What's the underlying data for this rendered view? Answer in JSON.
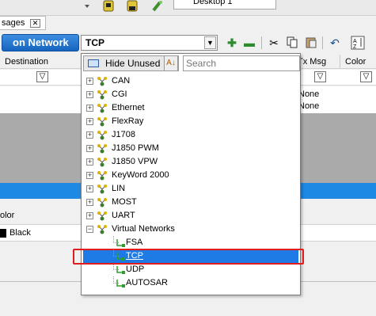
{
  "tabs": {
    "messages_tab_label": "sages",
    "desktop_tab_label": "Desktop 1"
  },
  "network_bar": {
    "network_button_label": "on Network",
    "selected_network": "TCP"
  },
  "grid": {
    "columns": [
      {
        "label": "Destination"
      },
      {
        "label": "Tx Msg"
      },
      {
        "label": "Color"
      }
    ],
    "rows": [
      {
        "tx_msg": "None"
      },
      {
        "tx_msg": "None"
      }
    ]
  },
  "lower_panel": {
    "color_label": "olor",
    "color_value": "Black",
    "swatch_color": "#000000"
  },
  "dropdown": {
    "hide_button_label": "Hide Unused",
    "search_placeholder": "Search",
    "items": [
      {
        "label": "CAN"
      },
      {
        "label": "CGI"
      },
      {
        "label": "Ethernet"
      },
      {
        "label": "FlexRay"
      },
      {
        "label": "J1708"
      },
      {
        "label": "J1850 PWM"
      },
      {
        "label": "J1850 VPW"
      },
      {
        "label": "KeyWord 2000"
      },
      {
        "label": "LIN"
      },
      {
        "label": "MOST"
      },
      {
        "label": "UART"
      },
      {
        "label": "Virtual Networks"
      },
      {
        "label": "FSA"
      },
      {
        "label": "TCP"
      },
      {
        "label": "UDP"
      },
      {
        "label": "AUTOSAR"
      }
    ]
  },
  "colors": {
    "accent_blue": "#1e88e5",
    "selection_blue": "#1e7be6",
    "highlight_red": "#e21c1c"
  }
}
